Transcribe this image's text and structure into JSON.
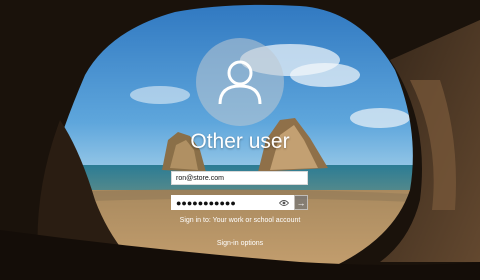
{
  "user": {
    "name": "Other user",
    "avatar_icon": "user-icon"
  },
  "login": {
    "email_value": "ron@store.com",
    "password_mask": "●●●●●●●●●●●",
    "reveal_icon": "eye-icon",
    "submit_icon": "arrow-right-icon",
    "submit_glyph": "→"
  },
  "signin_to": "Sign in to: Your work or school account",
  "signin_options": "Sign-in options",
  "colors": {
    "sky": "#3d8ac9",
    "sea": "#2a6f8a",
    "sand": "#b59162",
    "cave": "#1b140e",
    "text": "#ffffff"
  }
}
